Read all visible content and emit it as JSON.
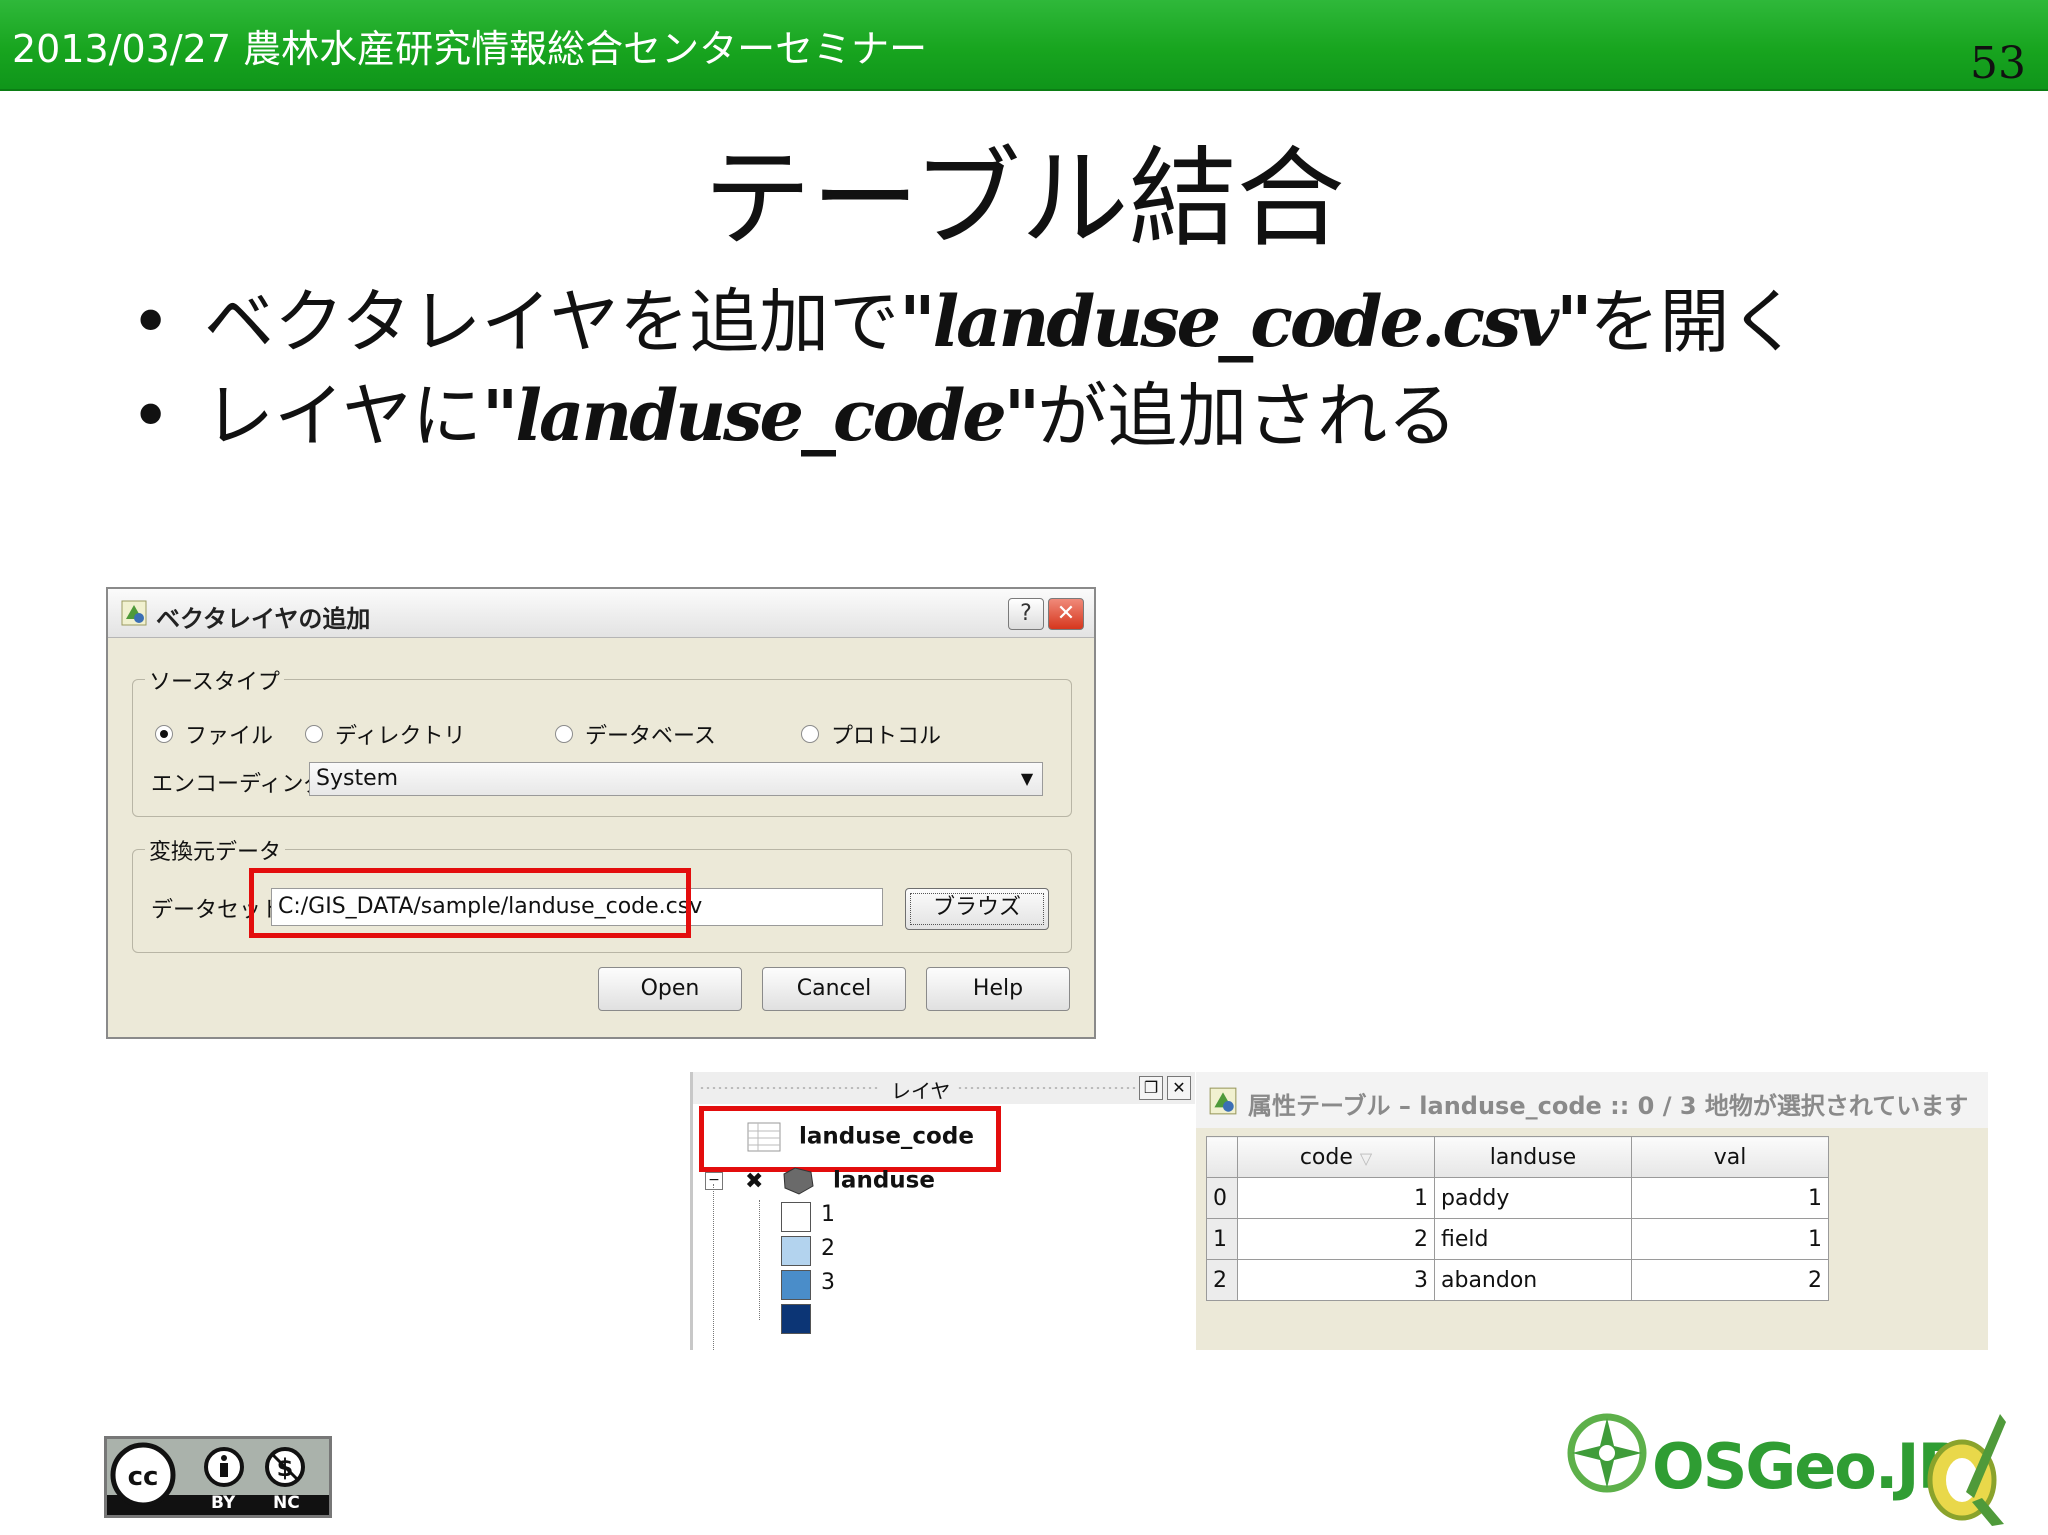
{
  "header": {
    "text": "2013/03/27 農林水産研究情報総合センターセミナー",
    "page_number": "53"
  },
  "title": "テーブル結合",
  "bullets": [
    {
      "pre": "ベクタレイヤを追加で",
      "code": "\"landuse_code.csv\"",
      "post": "を開く"
    },
    {
      "pre": "レイヤに",
      "code": "\"landuse_code\"",
      "post": "が追加される"
    }
  ],
  "dialog": {
    "title": "ベクタレイヤの追加",
    "help_btn": "?",
    "close_btn": "✕",
    "source_group": "ソースタイプ",
    "radios": [
      {
        "label": "ファイル",
        "checked": true
      },
      {
        "label": "ディレクトリ",
        "checked": false
      },
      {
        "label": "データベース",
        "checked": false
      },
      {
        "label": "プロトコル",
        "checked": false
      }
    ],
    "encoding_label": "エンコーディング",
    "encoding_value": "System",
    "data_group": "変換元データ",
    "dataset_label": "データセット",
    "dataset_value": "C:/GIS_DATA/sample/landuse_code.csv",
    "browse": "ブラウズ",
    "buttons": {
      "open": "Open",
      "cancel": "Cancel",
      "help": "Help"
    }
  },
  "layers": {
    "title": "レイヤ",
    "items": [
      "landuse_code",
      "landuse"
    ],
    "legend": [
      {
        "label": "1",
        "color": "#ffffff"
      },
      {
        "label": "2",
        "color": "#b3d3ee"
      },
      {
        "label": "3",
        "color": "#4a8dc9"
      },
      {
        "label": "",
        "color": "#0c3575"
      }
    ]
  },
  "attr_table": {
    "title": "属性テーブル – landuse_code :: 0 / 3 地物が選択されています",
    "columns": [
      "code",
      "landuse",
      "val"
    ],
    "rows": [
      {
        "idx": "0",
        "code": "1",
        "landuse": "paddy",
        "val": "1"
      },
      {
        "idx": "1",
        "code": "2",
        "landuse": "field",
        "val": "1"
      },
      {
        "idx": "2",
        "code": "3",
        "landuse": "abandon",
        "val": "2"
      }
    ]
  },
  "footer": {
    "cc": {
      "by": "BY",
      "nc": "NC"
    },
    "osgeo": "OSGeo.JP",
    "colors": {
      "header_green": "#18a51f",
      "highlight_red": "#e30d0d",
      "osgeo_green": "#2f9d33"
    }
  }
}
